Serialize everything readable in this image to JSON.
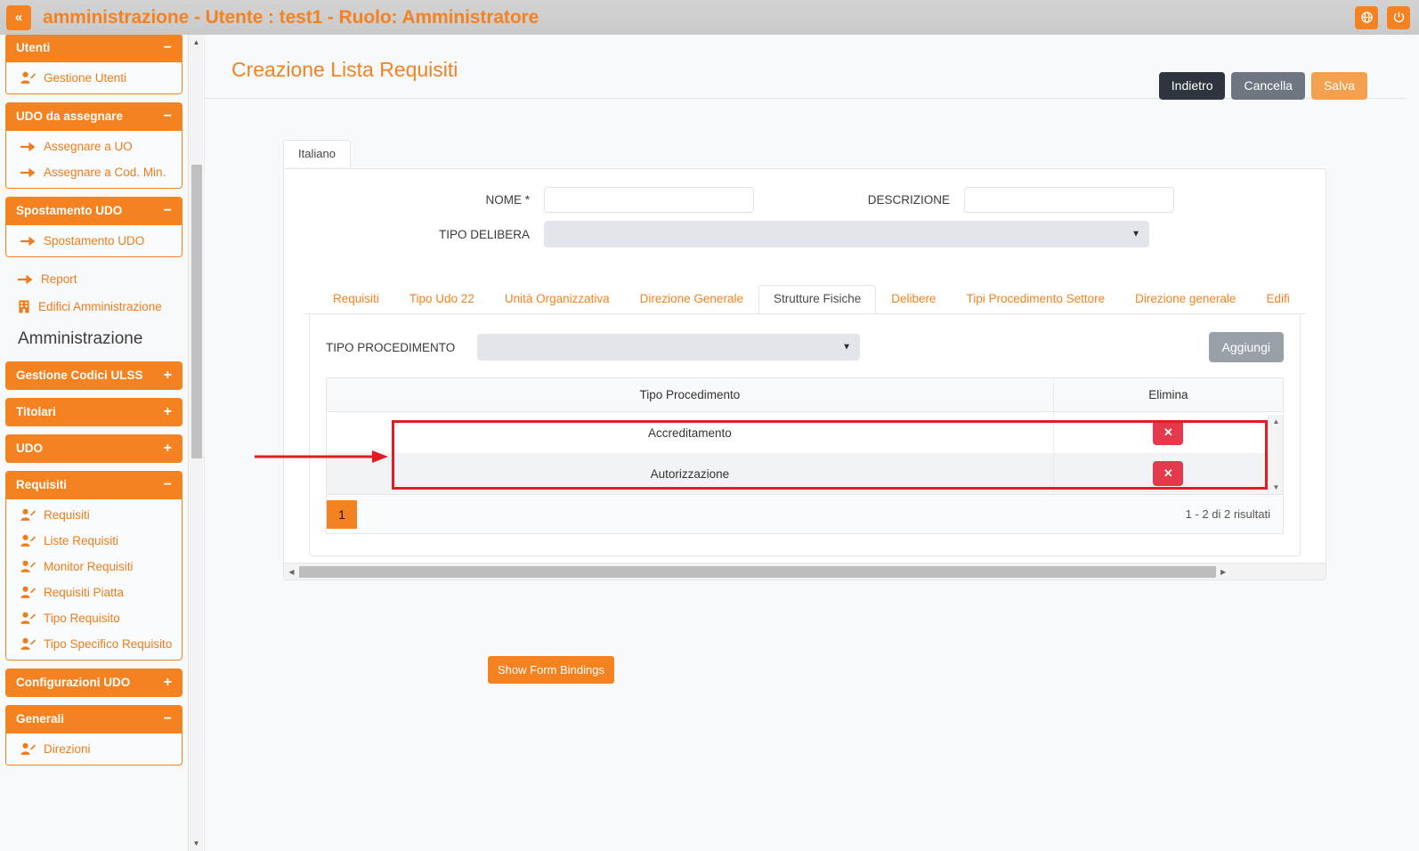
{
  "topbar": {
    "collapse_label": "«",
    "title": "amministrazione - Utente : test1 - Ruolo: Amministratore",
    "icons": [
      "globe-icon",
      "power-icon"
    ]
  },
  "sidebar": {
    "groups": [
      {
        "label": "Utenti",
        "sign": "−",
        "expanded": true,
        "items": [
          {
            "label": "Gestione Utenti",
            "icon": "user-edit-icon"
          }
        ]
      },
      {
        "label": "UDO da assegnare",
        "sign": "−",
        "expanded": true,
        "items": [
          {
            "label": "Assegnare a UO",
            "icon": "arrow-right-icon"
          },
          {
            "label": "Assegnare a Cod. Min.",
            "icon": "arrow-right-icon"
          }
        ]
      },
      {
        "label": "Spostamento UDO",
        "sign": "−",
        "expanded": true,
        "items": [
          {
            "label": "Spostamento UDO",
            "icon": "arrow-right-icon"
          }
        ]
      }
    ],
    "loose_items": [
      {
        "label": "Report",
        "icon": "arrow-right-icon"
      },
      {
        "label": "Edifici Amministrazione",
        "icon": "building-icon"
      }
    ],
    "section_title": "Amministrazione",
    "groups2": [
      {
        "label": "Gestione Codici ULSS",
        "sign": "+",
        "expanded": false,
        "items": []
      },
      {
        "label": "Titolari",
        "sign": "+",
        "expanded": false,
        "items": []
      },
      {
        "label": "UDO",
        "sign": "+",
        "expanded": false,
        "items": []
      },
      {
        "label": "Requisiti",
        "sign": "−",
        "expanded": true,
        "items": [
          {
            "label": "Requisiti",
            "icon": "user-edit-icon"
          },
          {
            "label": "Liste Requisiti",
            "icon": "user-edit-icon"
          },
          {
            "label": "Monitor Requisiti",
            "icon": "user-edit-icon"
          },
          {
            "label": "Requisiti Piatta",
            "icon": "user-edit-icon"
          },
          {
            "label": "Tipo Requisito",
            "icon": "user-edit-icon"
          },
          {
            "label": "Tipo Specifico Requisito",
            "icon": "user-edit-icon"
          }
        ]
      },
      {
        "label": "Configurazioni UDO",
        "sign": "+",
        "expanded": false,
        "items": []
      },
      {
        "label": "Generali",
        "sign": "−",
        "expanded": true,
        "items": [
          {
            "label": "Direzioni",
            "icon": "user-edit-icon"
          }
        ]
      }
    ]
  },
  "page": {
    "title": "Creazione Lista Requisiti",
    "actions": [
      {
        "label": "Indietro",
        "style": "dark"
      },
      {
        "label": "Cancella",
        "style": "gray"
      },
      {
        "label": "Salva",
        "style": "orange"
      }
    ]
  },
  "form": {
    "language_tab": "Italiano",
    "nome_label": "NOME *",
    "nome_value": "",
    "descrizione_label": "DESCRIZIONE",
    "descrizione_value": "",
    "tipo_delibera_label": "TIPO DELIBERA",
    "tipo_delibera_value": "",
    "caret": "▼"
  },
  "tabs": {
    "items": [
      "Requisiti",
      "Tipo Udo 22",
      "Unità Organizzativa",
      "Direzione Generale",
      "Strutture Fisiche",
      "Delibere",
      "Tipi Procedimento Settore",
      "Direzione generale",
      "Edifi"
    ],
    "active_index": 4
  },
  "panel": {
    "tipo_procedimento_label": "TIPO PROCEDIMENTO",
    "tipo_procedimento_value": "",
    "add_button": "Aggiungi",
    "table": {
      "columns": [
        "Tipo Procedimento",
        "Elimina"
      ],
      "rows": [
        {
          "tipo": "Accreditamento",
          "delete_label": "✕"
        },
        {
          "tipo": "Autorizzazione",
          "delete_label": "✕"
        }
      ]
    },
    "pagination": {
      "current_page": "1",
      "results_text": "1 - 2 di 2 risultati"
    }
  },
  "footer": {
    "show_bindings": "Show Form Bindings"
  },
  "colors": {
    "brand_orange": "#f58220",
    "danger_red": "#e3394a",
    "annotation_red": "#e31b23",
    "dark_button": "#2f353e",
    "gray_button": "#6d7681"
  }
}
